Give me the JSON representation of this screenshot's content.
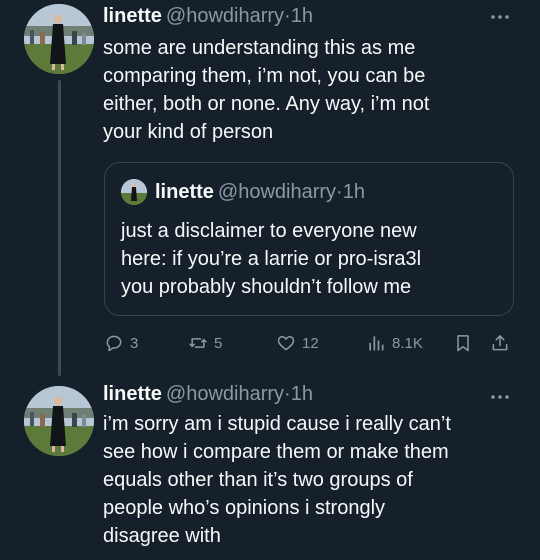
{
  "tweets": [
    {
      "author": {
        "name": "linette",
        "handle": "@howdiharry",
        "separator": "·",
        "time": "1h"
      },
      "text_lines": [
        "some are understanding this as me",
        "comparing them, i’m not, you can be",
        "either, both or none. Any way, i’m not",
        "your kind of person"
      ],
      "quoted": {
        "name": "linette",
        "handle": "@howdiharry",
        "separator": "·",
        "time": "1h",
        "text_lines": [
          "just a disclaimer to everyone new",
          "here: if you’re a larrie or pro-isra3l",
          "you probably shouldn’t follow me"
        ]
      },
      "metrics": {
        "replies": "3",
        "reposts": "5",
        "likes": "12",
        "views": "8.1K"
      }
    },
    {
      "author": {
        "name": "linette",
        "handle": "@howdiharry",
        "separator": "·",
        "time": "1h"
      },
      "text_lines": [
        "i’m sorry am i stupid cause i really can’t",
        "see how i compare them or make them",
        "equals other than it’s two groups of",
        "people who’s opinions i strongly",
        "disagree with"
      ]
    }
  ],
  "icons": {
    "more": "more-horizontal-icon",
    "reply": "reply-icon",
    "repost": "repost-icon",
    "like": "heart-icon",
    "views": "analytics-icon",
    "bookmark": "bookmark-icon",
    "share": "share-icon"
  },
  "colors": {
    "background": "#15202b",
    "text": "#f7f9f9",
    "secondary": "#8b98a5",
    "border": "#38444d"
  }
}
